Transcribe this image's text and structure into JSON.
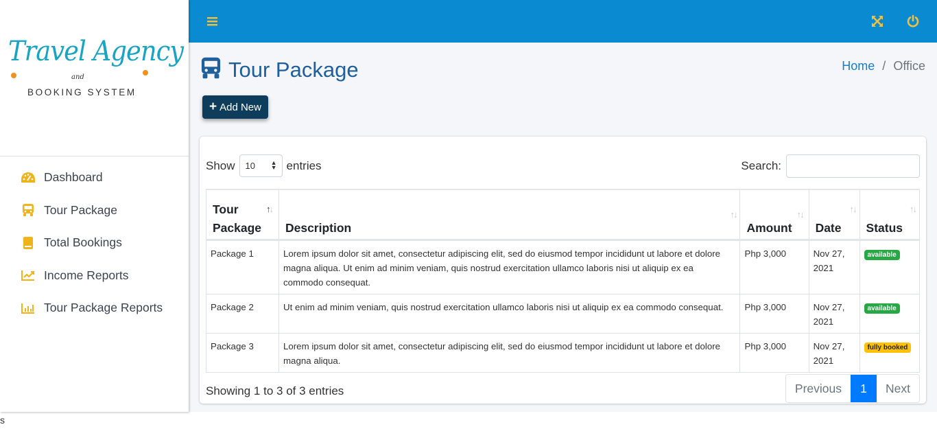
{
  "brand": {
    "title": "Travel Agency",
    "connector": "and",
    "subtitle": "BOOKING SYSTEM"
  },
  "sidebar": {
    "items": [
      {
        "label": "Dashboard",
        "icon": "tachometer-icon"
      },
      {
        "label": "Tour Package",
        "icon": "bus-icon"
      },
      {
        "label": "Total Bookings",
        "icon": "book-icon"
      },
      {
        "label": "Income Reports",
        "icon": "line-chart-icon"
      },
      {
        "label": "Tour Package Reports",
        "icon": "bar-chart-icon"
      }
    ]
  },
  "topbar": {
    "menu_icon": "hamburger-icon",
    "fullscreen_icon": "expand-arrows-icon",
    "power_icon": "power-icon"
  },
  "page": {
    "title": "Tour Package",
    "breadcrumb": {
      "home": "Home",
      "separator": "/",
      "current": "Office"
    },
    "add_button": "Add New"
  },
  "table_controls": {
    "show_label": "Show",
    "entries_label": "entries",
    "page_length": "10",
    "search_label": "Search:",
    "search_value": ""
  },
  "table": {
    "columns": [
      "Tour Package",
      "Description",
      "Amount",
      "Date",
      "Status"
    ],
    "rows": [
      {
        "package": "Package 1",
        "description": "Lorem ipsum dolor sit amet, consectetur adipiscing elit, sed do eiusmod tempor incididunt ut labore et dolore magna aliqua. Ut enim ad minim veniam, quis nostrud exercitation ullamco laboris nisi ut aliquip ex ea commodo consequat.",
        "amount": "Php 3,000",
        "date": "Nov 27, 2021",
        "status": "available",
        "status_color": "#28a745"
      },
      {
        "package": "Package 2",
        "description": "Ut enim ad minim veniam, quis nostrud exercitation ullamco laboris nisi ut aliquip ex ea commodo consequat.",
        "amount": "Php 3,000",
        "date": "Nov 27, 2021",
        "status": "available",
        "status_color": "#28a745"
      },
      {
        "package": "Package 3",
        "description": "Lorem ipsum dolor sit amet, consectetur adipiscing elit, sed do eiusmod tempor incididunt ut labore et dolore magna aliqua.",
        "amount": "Php 3,000",
        "date": "Nov 27, 2021",
        "status": "fully booked",
        "status_color": "#ffc107"
      }
    ]
  },
  "footer": {
    "info": "Showing 1 to 3 of 3 entries",
    "pagination": {
      "previous": "Previous",
      "current": "1",
      "next": "Next"
    }
  },
  "stray_text": "s",
  "colors": {
    "topbar": "#0a8ad0",
    "icon_accent": "#f0b41a",
    "title": "#1f5f9b",
    "add_button": "#0e3d5c",
    "page_active": "#007bff"
  }
}
